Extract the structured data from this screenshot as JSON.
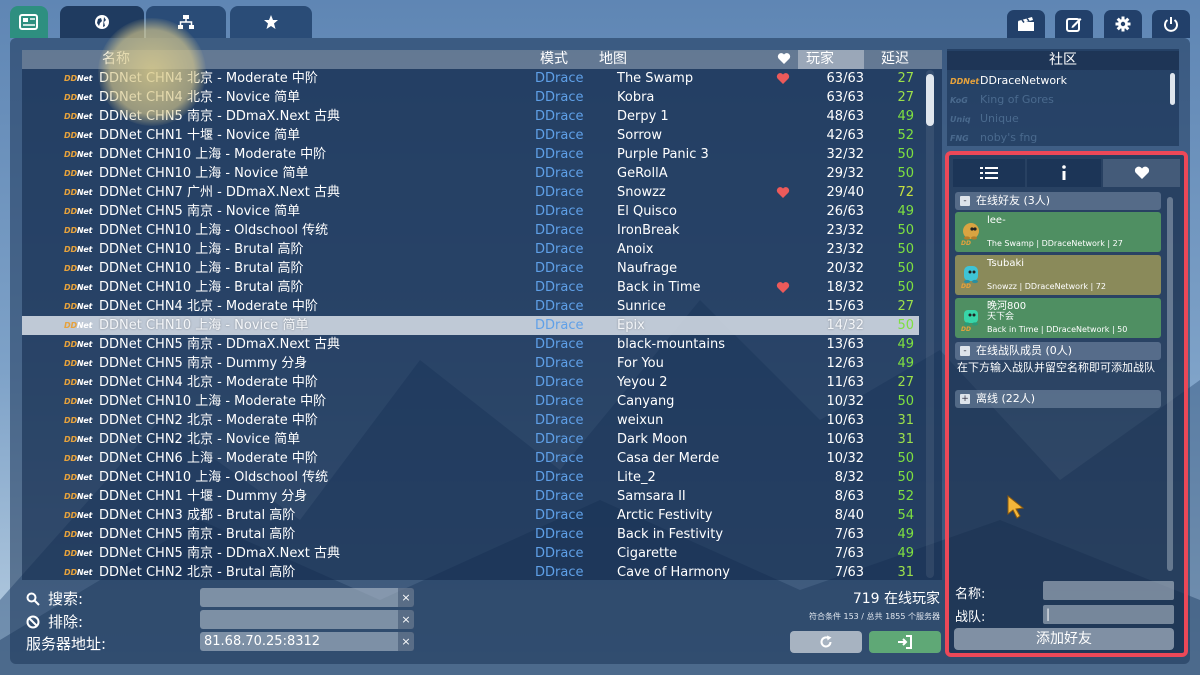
{
  "tabs": [
    {
      "name": "news",
      "icon": "news-icon"
    },
    {
      "name": "internet",
      "icon": "globe-icon"
    },
    {
      "name": "lan",
      "icon": "network-icon"
    },
    {
      "name": "favorites",
      "icon": "star-icon"
    }
  ],
  "top_buttons": [
    "demo-icon",
    "editor-icon",
    "settings-icon",
    "quit-icon"
  ],
  "list": {
    "headers": {
      "name": "名称",
      "mode": "模式",
      "map": "地图",
      "players": "玩家",
      "ping": "延迟"
    },
    "rows": [
      {
        "name": "DDNet CHN4 北京 - Moderate 中阶",
        "mode": "DDrace",
        "map": "The Swamp",
        "fav": true,
        "players": "63/63",
        "ping": "27",
        "ping_color": "#9de04a"
      },
      {
        "name": "DDNet CHN4 北京 - Novice 简单",
        "mode": "DDrace",
        "map": "Kobra",
        "fav": false,
        "players": "63/63",
        "ping": "27",
        "ping_color": "#9de04a"
      },
      {
        "name": "DDNet CHN5 南京 - DDmaX.Next 古典",
        "mode": "DDrace",
        "map": "Derpy 1",
        "fav": false,
        "players": "48/63",
        "ping": "49",
        "ping_color": "#7ee040"
      },
      {
        "name": "DDNet CHN1 十堰 - Novice 简单",
        "mode": "DDrace",
        "map": "Sorrow",
        "fav": false,
        "players": "42/63",
        "ping": "52",
        "ping_color": "#7ee040"
      },
      {
        "name": "DDNet CHN10 上海 - Moderate 中阶",
        "mode": "DDrace",
        "map": "Purple Panic 3",
        "fav": false,
        "players": "32/32",
        "ping": "50",
        "ping_color": "#7ee040"
      },
      {
        "name": "DDNet CHN10 上海 - Novice 简单",
        "mode": "DDrace",
        "map": "GeRollA",
        "fav": false,
        "players": "29/32",
        "ping": "50",
        "ping_color": "#7ee040"
      },
      {
        "name": "DDNet CHN7 广州 - DDmaX.Next 古典",
        "mode": "DDrace",
        "map": "Snowzz",
        "fav": true,
        "players": "29/40",
        "ping": "72",
        "ping_color": "#c6e040"
      },
      {
        "name": "DDNet CHN5 南京 - Novice 简单",
        "mode": "DDrace",
        "map": "El Quisco",
        "fav": false,
        "players": "26/63",
        "ping": "49",
        "ping_color": "#7ee040"
      },
      {
        "name": "DDNet CHN10 上海 - Oldschool 传统",
        "mode": "DDrace",
        "map": "IronBreak",
        "fav": false,
        "players": "23/32",
        "ping": "50",
        "ping_color": "#7ee040"
      },
      {
        "name": "DDNet CHN10 上海 - Brutal 高阶",
        "mode": "DDrace",
        "map": "Anoix",
        "fav": false,
        "players": "23/32",
        "ping": "50",
        "ping_color": "#7ee040"
      },
      {
        "name": "DDNet CHN10 上海 - Brutal 高阶",
        "mode": "DDrace",
        "map": "Naufrage",
        "fav": false,
        "players": "20/32",
        "ping": "50",
        "ping_color": "#7ee040"
      },
      {
        "name": "DDNet CHN10 上海 - Brutal 高阶",
        "mode": "DDrace",
        "map": "Back in Time",
        "fav": true,
        "players": "18/32",
        "ping": "50",
        "ping_color": "#7ee040"
      },
      {
        "name": "DDNet CHN4 北京 - Moderate 中阶",
        "mode": "DDrace",
        "map": "Sunrice",
        "fav": false,
        "players": "15/63",
        "ping": "27",
        "ping_color": "#9de04a"
      },
      {
        "name": "DDNet CHN10 上海 - Novice 简单",
        "mode": "DDrace",
        "map": "Epix",
        "fav": false,
        "players": "14/32",
        "ping": "50",
        "ping_color": "#7ee040",
        "selected": true
      },
      {
        "name": "DDNet CHN5 南京 - DDmaX.Next 古典",
        "mode": "DDrace",
        "map": "black-mountains",
        "fav": false,
        "players": "13/63",
        "ping": "49",
        "ping_color": "#7ee040"
      },
      {
        "name": "DDNet CHN5 南京 - Dummy 分身",
        "mode": "DDrace",
        "map": "For You",
        "fav": false,
        "players": "12/63",
        "ping": "49",
        "ping_color": "#7ee040"
      },
      {
        "name": "DDNet CHN4 北京 - Moderate 中阶",
        "mode": "DDrace",
        "map": "Yeyou 2",
        "fav": false,
        "players": "11/63",
        "ping": "27",
        "ping_color": "#9de04a"
      },
      {
        "name": "DDNet CHN10 上海 - Moderate 中阶",
        "mode": "DDrace",
        "map": "Canyang",
        "fav": false,
        "players": "10/32",
        "ping": "50",
        "ping_color": "#7ee040"
      },
      {
        "name": "DDNet CHN2 北京 - Moderate 中阶",
        "mode": "DDrace",
        "map": "weixun",
        "fav": false,
        "players": "10/63",
        "ping": "31",
        "ping_color": "#9de04a"
      },
      {
        "name": "DDNet CHN2 北京 - Novice 简单",
        "mode": "DDrace",
        "map": "Dark Moon",
        "fav": false,
        "players": "10/63",
        "ping": "31",
        "ping_color": "#9de04a"
      },
      {
        "name": "DDNet CHN6 上海 - Moderate 中阶",
        "mode": "DDrace",
        "map": "Casa der Merde",
        "fav": false,
        "players": "10/32",
        "ping": "50",
        "ping_color": "#7ee040"
      },
      {
        "name": "DDNet CHN10 上海 - Oldschool 传统",
        "mode": "DDrace",
        "map": "Lite_2",
        "fav": false,
        "players": "8/32",
        "ping": "50",
        "ping_color": "#7ee040"
      },
      {
        "name": "DDNet CHN1 十堰 - Dummy 分身",
        "mode": "DDrace",
        "map": "Samsara II",
        "fav": false,
        "players": "8/63",
        "ping": "52",
        "ping_color": "#7ee040"
      },
      {
        "name": "DDNet CHN3 成都 - Brutal 高阶",
        "mode": "DDrace",
        "map": "Arctic Festivity",
        "fav": false,
        "players": "8/40",
        "ping": "54",
        "ping_color": "#7ee040"
      },
      {
        "name": "DDNet CHN5 南京 - Brutal 高阶",
        "mode": "DDrace",
        "map": "Back in Festivity",
        "fav": false,
        "players": "7/63",
        "ping": "49",
        "ping_color": "#7ee040"
      },
      {
        "name": "DDNet CHN5 南京 - DDmaX.Next 古典",
        "mode": "DDrace",
        "map": "Cigarette",
        "fav": false,
        "players": "7/63",
        "ping": "49",
        "ping_color": "#7ee040"
      },
      {
        "name": "DDNet CHN2 北京 - Brutal 高阶",
        "mode": "DDrace",
        "map": "Cave of Harmony",
        "fav": false,
        "players": "7/63",
        "ping": "31",
        "ping_color": "#9de04a"
      }
    ]
  },
  "filters": {
    "search_label": "搜索:",
    "search_value": "",
    "exclude_label": "排除:",
    "exclude_value": "",
    "address_label": "服务器地址:",
    "address_value": "81.68.70.25:8312",
    "clear_glyph": "×"
  },
  "status": {
    "online_players": "719 在线玩家",
    "matched": "符合条件 153 / 总共 1855 个服务器"
  },
  "community": {
    "title": "社区",
    "items": [
      {
        "icon": "DDNet",
        "name": "DDraceNetwork",
        "active": true
      },
      {
        "icon": "KoG",
        "name": "King of Gores",
        "active": false
      },
      {
        "icon": "Uniq",
        "name": "Unique",
        "active": false
      },
      {
        "icon": "FNG",
        "name": "noby's fng",
        "active": false
      }
    ]
  },
  "friends": {
    "online_header": "在线好友 (3人)",
    "clan_header": "在线战队成员 (0人)",
    "clan_hint": "在下方输入战队并留空名称即可添加战队",
    "offline_header": "离线 (22人)",
    "expand_minus": "-",
    "expand_plus": "+",
    "list": [
      {
        "name": "lee-",
        "clan": "",
        "server": "The Swamp | DDraceNetwork | 27",
        "card_color": "#4f8f62",
        "tee_color": "#d9a441"
      },
      {
        "name": "Tsubaki",
        "clan": "",
        "server": "Snowzz | DDraceNetwork | 72",
        "card_color": "#8a8a5a",
        "tee_color": "#3fc4d6"
      },
      {
        "name": "晚河800",
        "clan": "天下会",
        "server": "Back in Time | DDraceNetwork | 50",
        "card_color": "#4f8f62",
        "tee_color": "#38d6a8"
      }
    ],
    "name_label": "名称:",
    "clan_label": "战队:",
    "name_value": "",
    "clan_value": "|",
    "add_button": "添加好友"
  }
}
